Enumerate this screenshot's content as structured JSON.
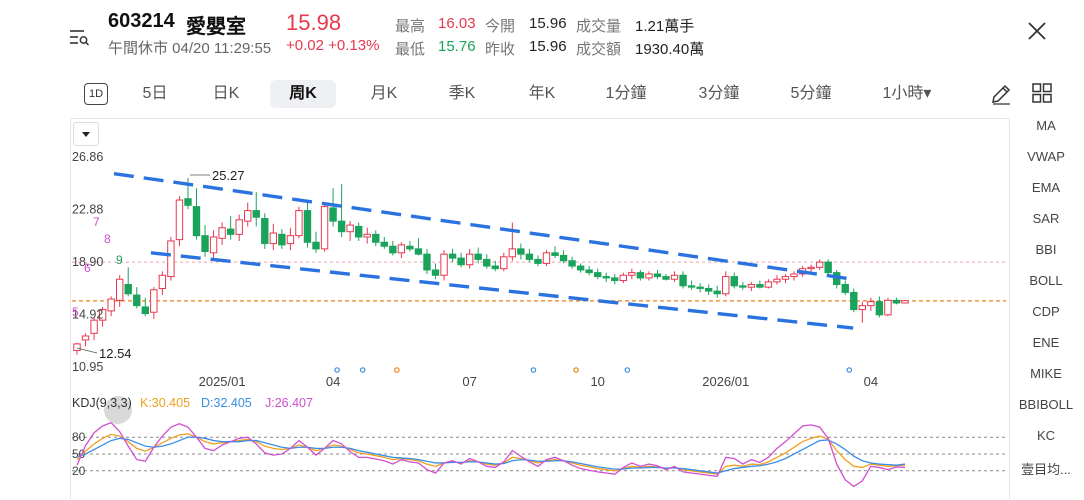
{
  "header": {
    "code": "603214",
    "name": "愛嬰室",
    "price": "15.98",
    "status": "午間休市 04/20 11:29:55",
    "change": "+0.02 +0.13%",
    "stats": [
      {
        "label": "最高",
        "value": "16.03",
        "tone": "red"
      },
      {
        "label": "今開",
        "value": "15.96",
        "tone": "neutral"
      },
      {
        "label": "成交量",
        "value": "1.21萬手",
        "tone": "neutral"
      },
      {
        "label": "最低",
        "value": "15.76",
        "tone": "green"
      },
      {
        "label": "昨收",
        "value": "15.96",
        "tone": "neutral"
      },
      {
        "label": "成交額",
        "value": "1930.40萬",
        "tone": "neutral"
      }
    ]
  },
  "tabs": {
    "oneday": "1D",
    "items": [
      "5日",
      "日K",
      "周K",
      "月K",
      "季K",
      "年K",
      "1分鐘",
      "3分鐘",
      "5分鐘",
      "1小時▾"
    ],
    "active_index": 2
  },
  "indicators": [
    "MA",
    "VWAP",
    "EMA",
    "SAR",
    "BBI",
    "BOLL",
    "CDP",
    "ENE",
    "MIKE",
    "BBIBOLL",
    "KC",
    "壹目均..."
  ],
  "colors": {
    "up": "#e8384f",
    "down": "#1aa35b",
    "trend": "#2a72e0",
    "k": "#f0a020",
    "d": "#3a8ee6",
    "j": "#d14fd1",
    "ref_orange": "#f07d1a"
  },
  "chart_data": {
    "type": "candlestick",
    "y_ticks": [
      "26.86",
      "22.88",
      "18.90",
      "14.92",
      "10.95"
    ],
    "ylim": [
      10.95,
      26.86
    ],
    "x_ticks": [
      "2025/01",
      "04",
      "07",
      "10",
      "2026/01",
      "04"
    ],
    "annotations": {
      "high": "25.27",
      "low": "12.54",
      "seq_labels": [
        "7",
        "8",
        "9",
        "6",
        "5"
      ]
    },
    "reference_lines": {
      "prev_close": 15.96,
      "dashed_pink": 18.9
    },
    "ohlc": [
      [
        12.2,
        12.8,
        11.9,
        12.7
      ],
      [
        13.0,
        13.5,
        12.5,
        13.3
      ],
      [
        13.5,
        14.7,
        13.0,
        14.5
      ],
      [
        14.5,
        15.5,
        14.0,
        15.3
      ],
      [
        15.2,
        16.3,
        14.8,
        16.1
      ],
      [
        16.0,
        17.9,
        15.5,
        17.6
      ],
      [
        17.2,
        18.5,
        16.3,
        16.5
      ],
      [
        16.4,
        17.0,
        15.4,
        15.6
      ],
      [
        15.5,
        16.2,
        14.8,
        15.0
      ],
      [
        15.1,
        17.0,
        14.6,
        16.8
      ],
      [
        16.9,
        18.2,
        16.4,
        17.9
      ],
      [
        17.8,
        20.8,
        17.5,
        20.5
      ],
      [
        20.6,
        23.9,
        20.1,
        23.6
      ],
      [
        23.7,
        25.27,
        22.9,
        23.2
      ],
      [
        23.1,
        24.5,
        20.6,
        20.9
      ],
      [
        20.9,
        21.7,
        19.3,
        19.7
      ],
      [
        19.6,
        21.3,
        19.2,
        20.8
      ],
      [
        20.7,
        21.9,
        20.2,
        21.5
      ],
      [
        21.4,
        22.4,
        20.6,
        21.0
      ],
      [
        21.0,
        22.5,
        20.5,
        22.1
      ],
      [
        22.0,
        23.4,
        21.6,
        22.8
      ],
      [
        22.8,
        24.2,
        21.6,
        22.3
      ],
      [
        22.2,
        22.6,
        19.9,
        20.3
      ],
      [
        20.3,
        21.8,
        19.8,
        21.1
      ],
      [
        21.0,
        21.4,
        19.9,
        20.2
      ],
      [
        20.3,
        21.5,
        19.8,
        20.9
      ],
      [
        20.9,
        23.1,
        20.7,
        22.8
      ],
      [
        22.8,
        23.6,
        20.0,
        20.4
      ],
      [
        20.4,
        21.2,
        19.6,
        19.9
      ],
      [
        19.9,
        23.4,
        19.7,
        23.1
      ],
      [
        23.0,
        24.5,
        21.6,
        22.0
      ],
      [
        22.0,
        24.8,
        20.8,
        21.2
      ],
      [
        21.2,
        22.0,
        20.5,
        21.7
      ],
      [
        21.6,
        21.9,
        20.5,
        20.8
      ],
      [
        20.8,
        21.5,
        20.3,
        21.0
      ],
      [
        21.0,
        21.3,
        20.1,
        20.4
      ],
      [
        20.4,
        20.8,
        19.9,
        20.1
      ],
      [
        20.1,
        20.5,
        19.4,
        19.6
      ],
      [
        19.6,
        20.4,
        19.2,
        20.2
      ],
      [
        20.1,
        20.5,
        19.7,
        19.9
      ],
      [
        19.9,
        20.7,
        19.4,
        19.5
      ],
      [
        19.5,
        19.9,
        18.0,
        18.3
      ],
      [
        18.3,
        18.8,
        17.6,
        17.9
      ],
      [
        17.9,
        19.8,
        17.5,
        19.5
      ],
      [
        19.5,
        19.9,
        18.9,
        19.2
      ],
      [
        19.2,
        19.6,
        18.5,
        18.7
      ],
      [
        18.7,
        19.9,
        18.4,
        19.5
      ],
      [
        19.5,
        20.0,
        18.8,
        19.1
      ],
      [
        19.1,
        19.5,
        18.4,
        18.6
      ],
      [
        18.6,
        19.0,
        18.2,
        18.4
      ],
      [
        18.4,
        19.6,
        18.2,
        19.3
      ],
      [
        19.3,
        21.9,
        19.0,
        19.9
      ],
      [
        19.9,
        20.3,
        19.1,
        19.5
      ],
      [
        19.5,
        19.9,
        18.9,
        19.1
      ],
      [
        19.1,
        19.4,
        18.6,
        18.8
      ],
      [
        18.8,
        19.8,
        18.6,
        19.6
      ],
      [
        19.6,
        20.1,
        19.2,
        19.4
      ],
      [
        19.4,
        19.8,
        18.8,
        19.0
      ],
      [
        19.0,
        19.3,
        18.4,
        18.6
      ],
      [
        18.6,
        18.8,
        18.1,
        18.3
      ],
      [
        18.3,
        18.6,
        17.9,
        18.1
      ],
      [
        18.1,
        18.4,
        17.6,
        17.8
      ],
      [
        17.8,
        18.1,
        17.4,
        17.7
      ],
      [
        17.7,
        18.0,
        17.2,
        17.5
      ],
      [
        17.5,
        18.1,
        17.3,
        17.9
      ],
      [
        17.9,
        18.4,
        17.6,
        18.1
      ],
      [
        18.1,
        18.3,
        17.5,
        17.7
      ],
      [
        17.7,
        18.2,
        17.5,
        18.0
      ],
      [
        18.0,
        18.3,
        17.6,
        17.8
      ],
      [
        17.8,
        18.0,
        17.5,
        17.6
      ],
      [
        17.6,
        18.2,
        17.4,
        17.9
      ],
      [
        17.9,
        18.2,
        16.9,
        17.1
      ],
      [
        17.1,
        17.5,
        16.8,
        17.0
      ],
      [
        17.0,
        17.3,
        16.6,
        16.9
      ],
      [
        16.9,
        17.2,
        16.4,
        16.7
      ],
      [
        16.7,
        17.1,
        16.2,
        16.5
      ],
      [
        16.5,
        18.2,
        16.3,
        17.8
      ],
      [
        17.8,
        18.1,
        16.9,
        17.1
      ],
      [
        17.1,
        17.4,
        16.8,
        17.0
      ],
      [
        17.0,
        17.4,
        16.7,
        17.2
      ],
      [
        17.2,
        17.5,
        16.9,
        17.0
      ],
      [
        17.0,
        17.6,
        16.9,
        17.4
      ],
      [
        17.4,
        17.9,
        17.2,
        17.6
      ],
      [
        17.6,
        18.0,
        17.3,
        17.8
      ],
      [
        17.8,
        18.2,
        17.5,
        18.0
      ],
      [
        18.0,
        18.6,
        17.8,
        18.4
      ],
      [
        18.4,
        18.7,
        18.1,
        18.5
      ],
      [
        18.5,
        19.1,
        18.3,
        18.9
      ],
      [
        18.9,
        19.1,
        17.9,
        18.1
      ],
      [
        18.1,
        18.3,
        16.9,
        17.2
      ],
      [
        17.2,
        17.5,
        16.4,
        16.6
      ],
      [
        16.6,
        16.9,
        15.1,
        15.3
      ],
      [
        15.3,
        15.9,
        14.3,
        15.6
      ],
      [
        15.6,
        16.2,
        15.2,
        15.9
      ],
      [
        15.9,
        16.3,
        14.7,
        14.9
      ],
      [
        14.9,
        16.2,
        14.8,
        16.0
      ],
      [
        16.0,
        16.2,
        15.7,
        15.8
      ],
      [
        15.8,
        16.03,
        15.76,
        15.98
      ]
    ],
    "trend_lines": [
      [
        [
          "2024-10",
          25.6
        ],
        [
          "2026-06",
          17.6
        ]
      ],
      [
        [
          "2024-11",
          19.6
        ],
        [
          "2026-06",
          13.9
        ]
      ]
    ],
    "kdj": {
      "label": "KDJ(9,3,3)",
      "k_label": "K:30.405",
      "d_label": "D:32.405",
      "j_label": "J:26.407",
      "y_ticks": [
        "80",
        "50",
        "20"
      ],
      "k": [
        40,
        55,
        68,
        78,
        85,
        82,
        72,
        60,
        55,
        62,
        70,
        78,
        84,
        86,
        80,
        72,
        68,
        70,
        72,
        74,
        76,
        72,
        64,
        60,
        58,
        60,
        66,
        62,
        56,
        60,
        66,
        64,
        58,
        52,
        50,
        47,
        44,
        40,
        42,
        40,
        38,
        32,
        28,
        34,
        36,
        34,
        38,
        36,
        32,
        30,
        34,
        44,
        42,
        38,
        34,
        38,
        40,
        38,
        34,
        30,
        27,
        24,
        22,
        20,
        24,
        28,
        26,
        28,
        27,
        24,
        26,
        22,
        20,
        18,
        16,
        14,
        28,
        30,
        28,
        32,
        31,
        36,
        44,
        52,
        62,
        72,
        78,
        82,
        76,
        56,
        40,
        28,
        26,
        32,
        30,
        28,
        29,
        30
      ],
      "d": [
        45,
        50,
        58,
        66,
        74,
        78,
        76,
        70,
        64,
        62,
        64,
        68,
        74,
        80,
        80,
        78,
        74,
        72,
        72,
        72,
        74,
        74,
        70,
        66,
        62,
        60,
        62,
        62,
        60,
        60,
        62,
        62,
        60,
        56,
        53,
        50,
        47,
        44,
        43,
        42,
        40,
        37,
        34,
        34,
        35,
        35,
        36,
        36,
        34,
        32,
        33,
        38,
        40,
        39,
        37,
        37,
        38,
        38,
        36,
        33,
        30,
        27,
        25,
        23,
        23,
        25,
        25,
        26,
        26,
        25,
        25,
        24,
        22,
        20,
        18,
        16,
        20,
        24,
        26,
        28,
        29,
        32,
        36,
        42,
        50,
        58,
        66,
        74,
        75,
        68,
        58,
        46,
        38,
        34,
        32,
        31,
        30,
        32
      ],
      "j": [
        30,
        65,
        88,
        100,
        106,
        90,
        64,
        40,
        37,
        62,
        82,
        98,
        104,
        98,
        80,
        60,
        56,
        66,
        72,
        78,
        80,
        68,
        52,
        48,
        50,
        60,
        74,
        62,
        48,
        60,
        74,
        68,
        54,
        44,
        44,
        41,
        38,
        32,
        40,
        36,
        34,
        22,
        16,
        34,
        38,
        32,
        42,
        36,
        28,
        26,
        36,
        56,
        46,
        36,
        28,
        40,
        44,
        38,
        30,
        24,
        21,
        18,
        16,
        14,
        26,
        34,
        28,
        32,
        29,
        22,
        28,
        18,
        16,
        14,
        12,
        10,
        44,
        42,
        32,
        40,
        35,
        44,
        60,
        72,
        86,
        100,
        102,
        98,
        78,
        32,
        4,
        -8,
        2,
        28,
        26,
        22,
        27,
        26
      ]
    }
  }
}
